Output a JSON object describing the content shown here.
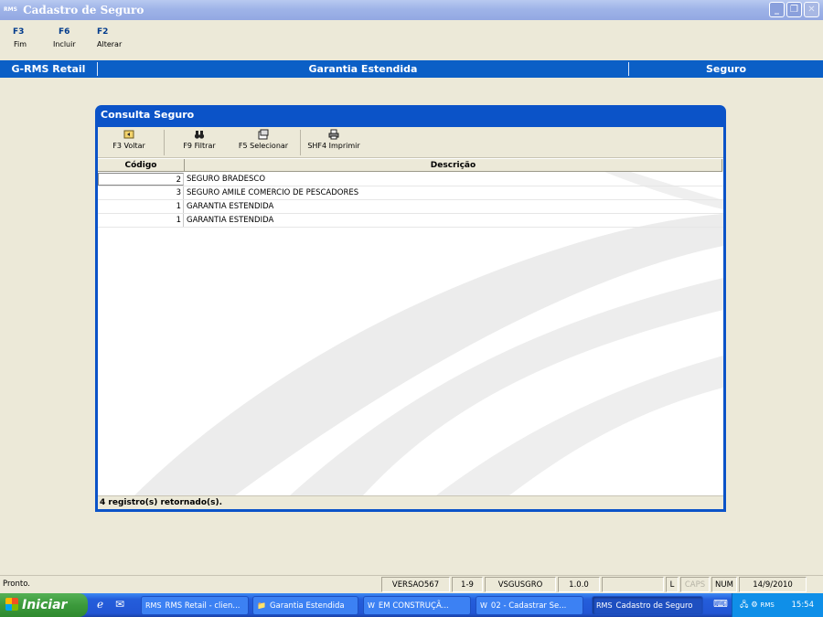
{
  "window": {
    "app_icon_text": "RMS",
    "title": "Cadastro de Seguro",
    "buttons": {
      "minimize": "_",
      "restore": "❐",
      "close": "✕"
    }
  },
  "fkeys": [
    {
      "key": "F3",
      "label": "Fim"
    },
    {
      "key": "F6",
      "label": "Incluir"
    },
    {
      "key": "F2",
      "label": "Alterar"
    }
  ],
  "band": {
    "left": "G-RMS Retail",
    "center": "Garantia Estendida",
    "right": "Seguro"
  },
  "dialog": {
    "title": "Consulta Seguro",
    "toolbar": [
      {
        "label": "F3 Voltar",
        "icon": "back-icon"
      },
      {
        "label": "F9 Filtrar",
        "icon": "binoculars-icon"
      },
      {
        "label": "F5 Selecionar",
        "icon": "select-icon"
      },
      {
        "label": "SHF4 Imprimir",
        "icon": "printer-icon"
      }
    ],
    "columns": [
      "Código",
      "Descrição"
    ],
    "rows": [
      {
        "codigo": "2",
        "descricao": "SEGURO BRADESCO"
      },
      {
        "codigo": "3",
        "descricao": "SEGURO AMILE COMERCIO DE PESCADORES"
      },
      {
        "codigo": "1",
        "descricao": "GARANTIA ESTENDIDA"
      },
      {
        "codigo": "1",
        "descricao": "GARANTIA ESTENDIDA"
      }
    ],
    "status": "4 registro(s) retornado(s)."
  },
  "statusbar": {
    "message": "Pronto.",
    "panels": [
      "VERSAO567",
      "1-9",
      "VSGUSGRO",
      "1.0.0",
      "",
      "L",
      "CAPS",
      "NUM",
      "14/9/2010"
    ]
  },
  "taskbar": {
    "start": "Iniciar",
    "tasks": [
      {
        "label": "RMS Retail - clien...",
        "icon_text": "RMS"
      },
      {
        "label": "Garantia Estendida",
        "icon_text": "📁"
      },
      {
        "label": "EM CONSTRUÇÃ...",
        "icon_text": "W"
      },
      {
        "label": "02 - Cadastrar Se...",
        "icon_text": "W"
      },
      {
        "label": "Cadastro de Seguro",
        "icon_text": "RMS"
      }
    ],
    "tray_icon_text": "RMS",
    "time": "15:54"
  }
}
